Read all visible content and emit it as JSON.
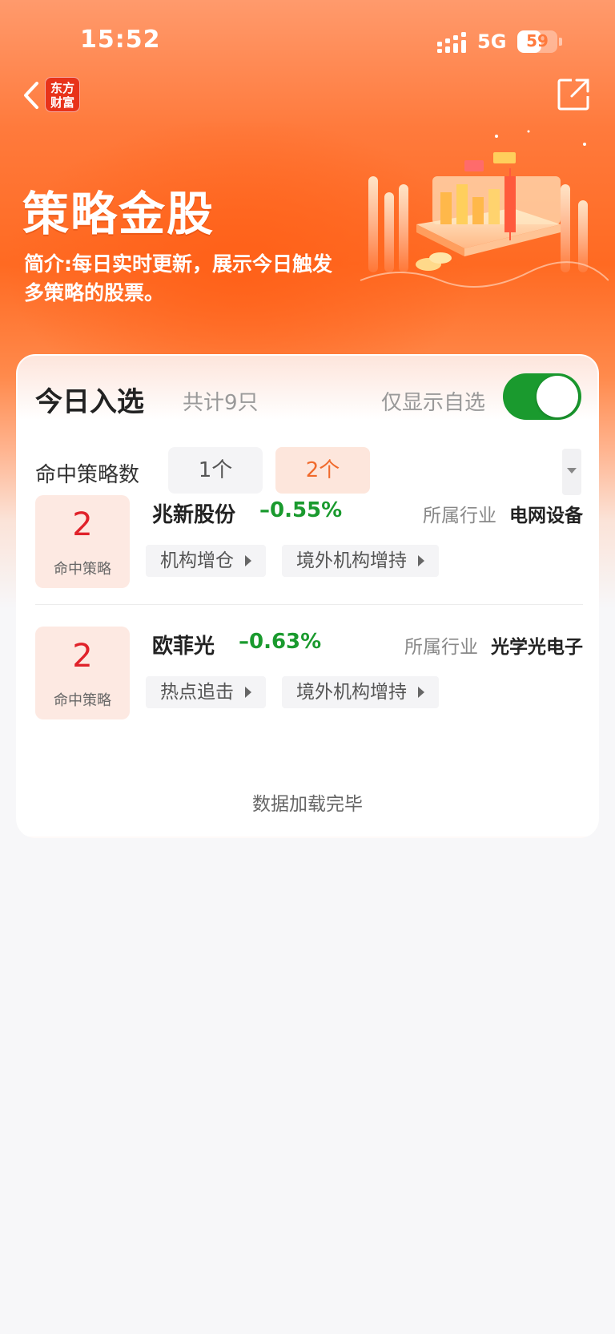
{
  "status_bar": {
    "time": "15:52",
    "network": "5G",
    "battery": "59",
    "battery_level": 0.59
  },
  "header": {
    "logo_text": "东方财富",
    "logo_line1": "东方",
    "logo_line2": "财富"
  },
  "hero": {
    "title": "策略金股",
    "description": "简介:每日实时更新，展示今日触发多策略的股票。"
  },
  "card": {
    "title": "今日入选",
    "count": "共计9只",
    "filter_label": "仅显示自选",
    "toggle_on": true,
    "hit_label": "命中策略数",
    "hit_options": [
      "1个",
      "2个"
    ],
    "selected_hit": "2个"
  },
  "stocks": [
    {
      "score": "2",
      "score_label": "命中策略",
      "name": "兆新股份",
      "change": "–0.55%",
      "industry_label": "所属行业",
      "industry": "电网设备",
      "tags": [
        "机构增仓",
        "境外机构增持"
      ]
    },
    {
      "score": "2",
      "score_label": "命中策略",
      "name": "欧菲光",
      "change": "–0.63%",
      "industry_label": "所属行业",
      "industry": "光学光电子",
      "tags": [
        "热点追击",
        "境外机构增持"
      ]
    }
  ],
  "footer_text": "数据加载完毕",
  "colors": {
    "accent": "#ff6a22",
    "up_red": "#e0222a",
    "down_green": "#1a9a2e",
    "toggle_green": "#1a9a2e"
  },
  "icons": {
    "back": "chevron-left-icon",
    "share": "share-icon",
    "signal": "signal-icon",
    "dropdown": "dropdown-icon",
    "tag_arrow": "triangle-right-icon"
  }
}
